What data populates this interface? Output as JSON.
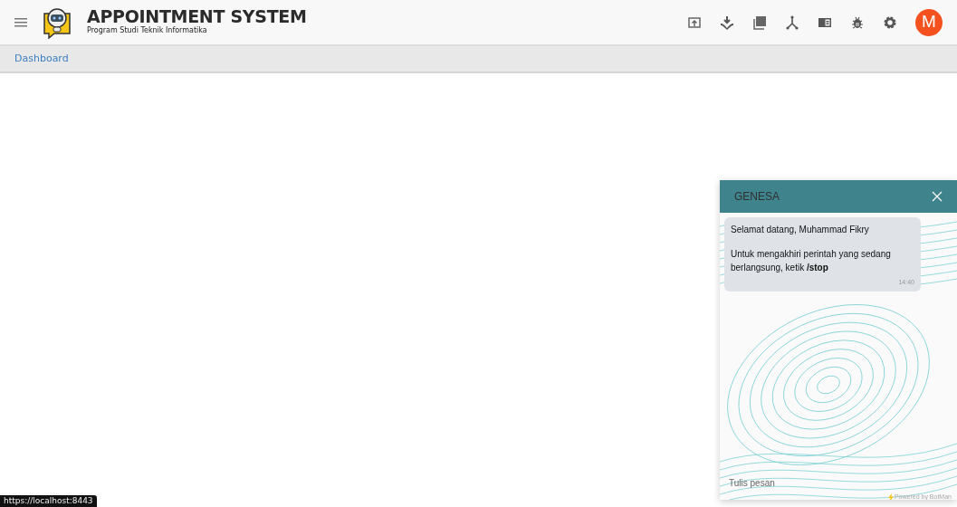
{
  "header": {
    "title": "APPOINTMENT SYSTEM",
    "subtitle": "Program Studi Teknik Informatika",
    "avatar": "M"
  },
  "breadcrumb": [
    {
      "label": "Dashboard"
    }
  ],
  "chat": {
    "title": "GENESA",
    "messages": [
      {
        "paragraphs": [
          "Selamat datang, Muhammad Fikry",
          "Untuk mengakhiri perintah yang sedang berlangsung, ketik **/stop**"
        ],
        "time": "14:40"
      }
    ],
    "input": {
      "placeholder": "Tulis pesan"
    },
    "footer": "Powered by BotMan"
  },
  "status_bar": {
    "url": "https://localhost:8443"
  }
}
